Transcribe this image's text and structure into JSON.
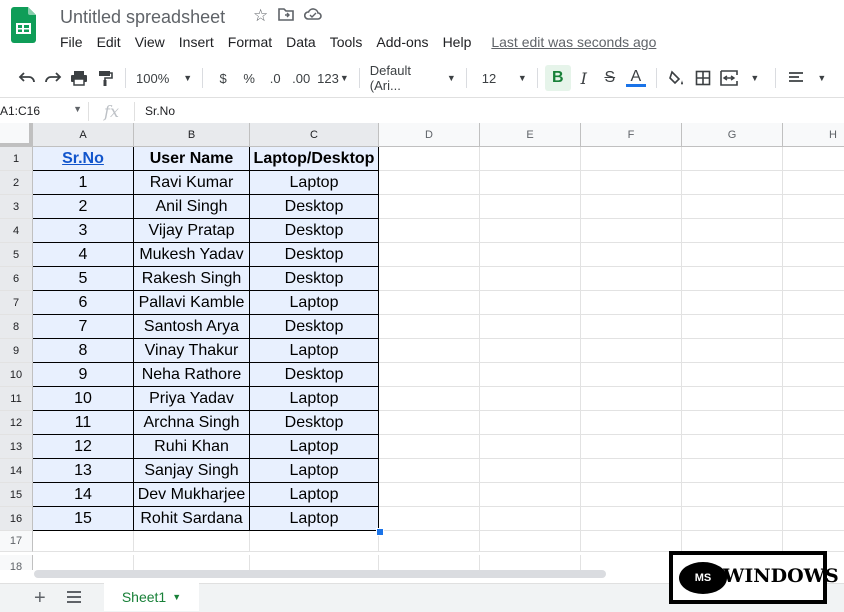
{
  "doc": {
    "title": "Untitled spreadsheet",
    "last_edit": "Last edit was seconds ago"
  },
  "menu": [
    "File",
    "Edit",
    "View",
    "Insert",
    "Format",
    "Data",
    "Tools",
    "Add-ons",
    "Help"
  ],
  "toolbar": {
    "zoom": "100%",
    "currency": "$",
    "percent": "%",
    "dec_less": ".0",
    "dec_more": ".00",
    "format_more": "123",
    "font": "Default (Ari...",
    "font_size": "12",
    "bold": "B",
    "italic": "I",
    "strike": "S",
    "text_color": "A"
  },
  "formula_bar": {
    "name_box": "A1:C16",
    "fx": "fx",
    "content": "Sr.No"
  },
  "columns": [
    "A",
    "B",
    "C",
    "D",
    "E",
    "F",
    "G",
    "H"
  ],
  "rows": [
    "1",
    "2",
    "3",
    "4",
    "5",
    "6",
    "7",
    "8",
    "9",
    "10",
    "11",
    "12",
    "13",
    "14",
    "15",
    "16",
    "17",
    "18"
  ],
  "table": {
    "headers": [
      "Sr.No",
      "User Name",
      "Laptop/Desktop"
    ],
    "data": [
      [
        "1",
        "Ravi Kumar",
        "Laptop"
      ],
      [
        "2",
        "Anil Singh",
        "Desktop"
      ],
      [
        "3",
        "Vijay Pratap",
        "Desktop"
      ],
      [
        "4",
        "Mukesh Yadav",
        "Desktop"
      ],
      [
        "5",
        "Rakesh Singh",
        "Desktop"
      ],
      [
        "6",
        "Pallavi Kamble",
        "Laptop"
      ],
      [
        "7",
        "Santosh Arya",
        "Desktop"
      ],
      [
        "8",
        "Vinay Thakur",
        "Laptop"
      ],
      [
        "9",
        "Neha Rathore",
        "Desktop"
      ],
      [
        "10",
        "Priya Yadav",
        "Laptop"
      ],
      [
        "11",
        "Archna Singh",
        "Desktop"
      ],
      [
        "12",
        "Ruhi Khan",
        "Laptop"
      ],
      [
        "13",
        "Sanjay Singh",
        "Laptop"
      ],
      [
        "14",
        "Dev Mukharjee",
        "Laptop"
      ],
      [
        "15",
        "Rohit Sardana",
        "Laptop"
      ]
    ]
  },
  "sheet_tab": "Sheet1",
  "watermark": {
    "badge": "MS",
    "text": "WINDOWS"
  },
  "colors": {
    "accent_green": "#188038",
    "selection_fill": "#e8f0fe",
    "link_blue": "#1155cc",
    "selection_handle": "#1a73e8"
  }
}
